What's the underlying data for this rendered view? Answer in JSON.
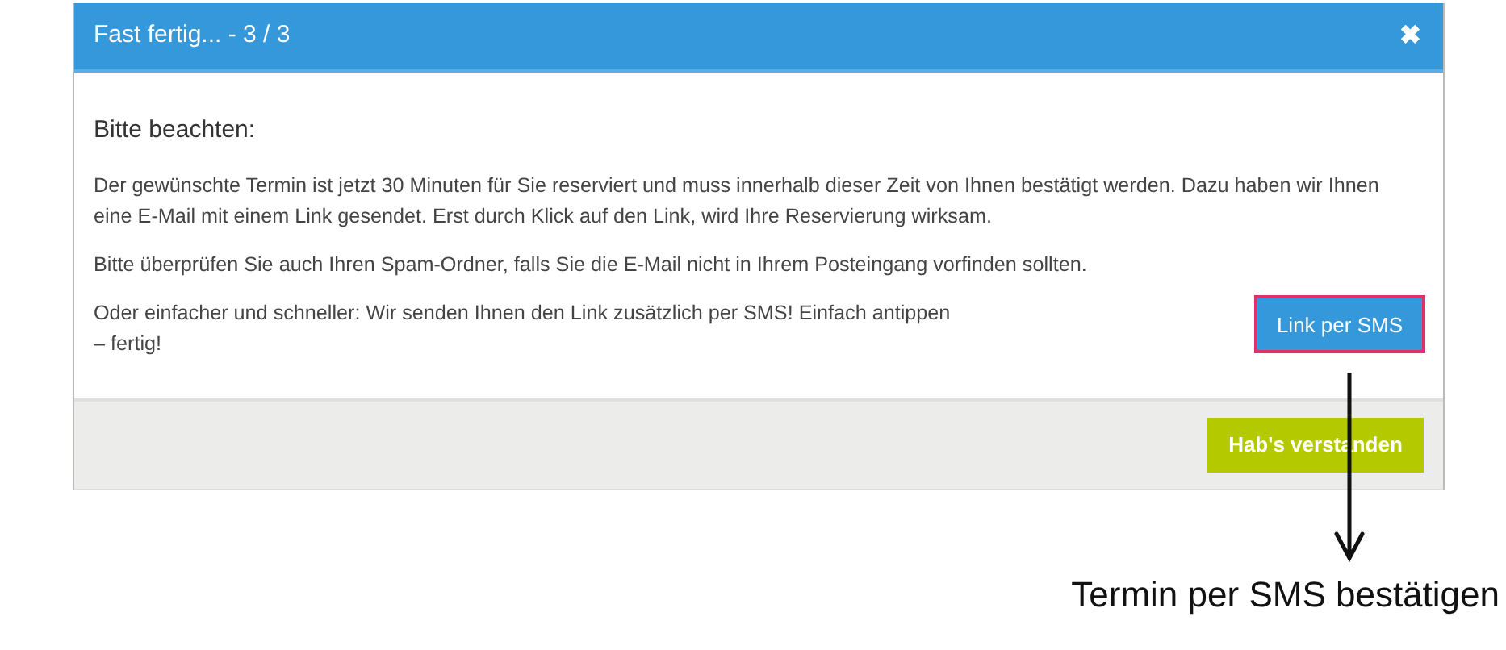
{
  "dialog": {
    "title": "Fast fertig... - 3 / 3",
    "close_icon": "✖",
    "heading": "Bitte beachten:",
    "paragraphs": [
      "Der gewünschte Termin ist jetzt 30 Minuten für Sie reserviert und muss innerhalb dieser Zeit von Ihnen bestätigt werden. Dazu haben wir Ihnen eine E-Mail mit einem Link gesendet. Erst durch Klick auf den Link, wird Ihre Reservierung wirksam.",
      "Bitte überprüfen Sie auch Ihren Spam-Ordner, falls Sie die E-Mail nicht in Ihrem Posteingang vorfinden sollten."
    ],
    "sms_text": "Oder einfacher und schneller: Wir senden Ihnen den Link zusätzlich per SMS! Einfach antippen – fertig!",
    "sms_button": {
      "label": "Link per SMS",
      "highlighted": true
    },
    "footer_button": "Hab's verstanden"
  },
  "annotation": {
    "text": "Termin per SMS bestätigen"
  }
}
